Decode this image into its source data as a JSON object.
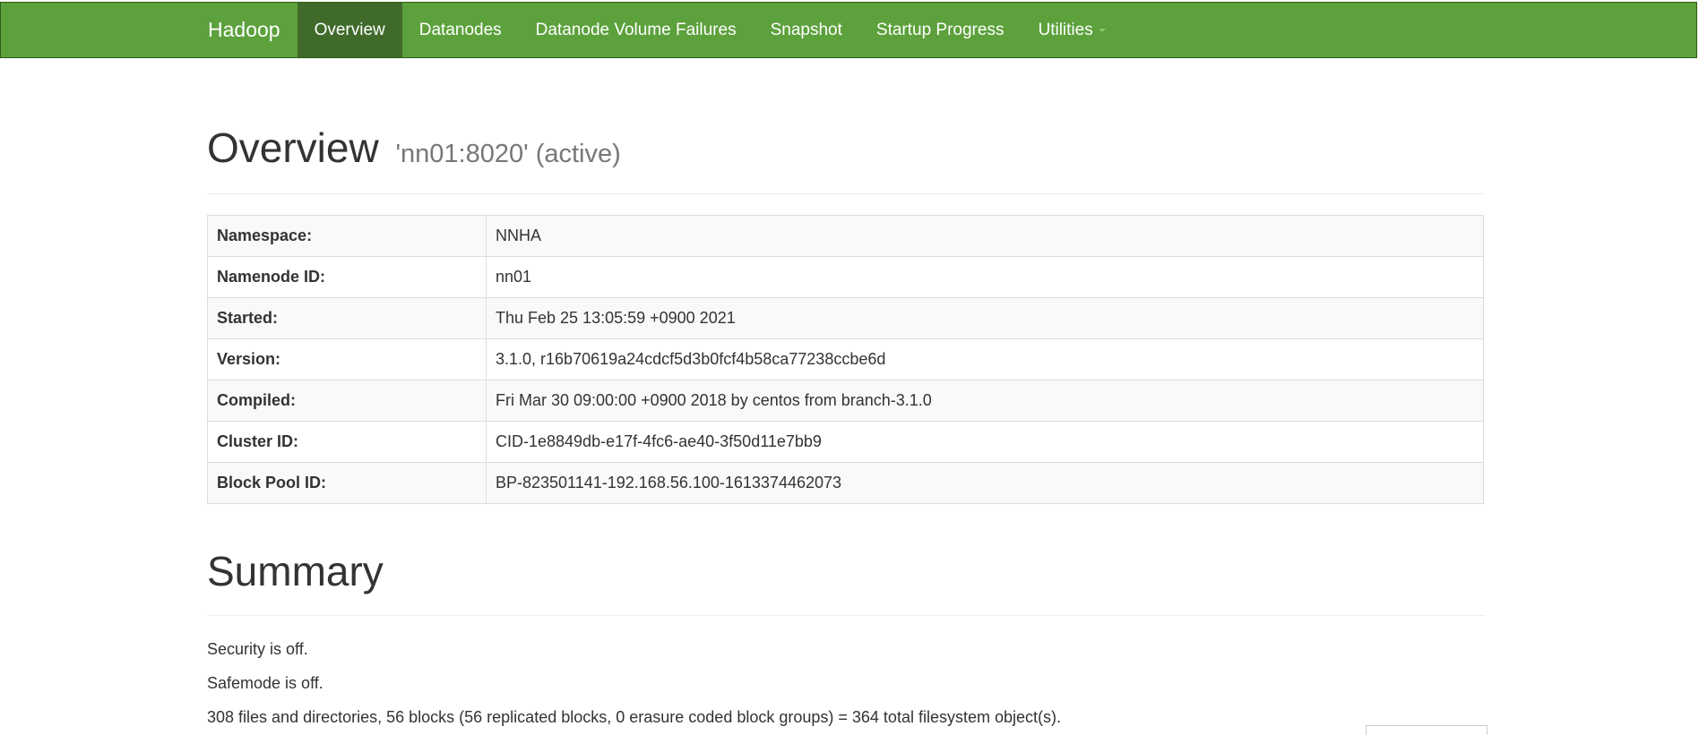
{
  "navbar": {
    "brand": "Hadoop",
    "items": [
      {
        "label": "Overview",
        "active": true
      },
      {
        "label": "Datanodes",
        "active": false
      },
      {
        "label": "Datanode Volume Failures",
        "active": false
      },
      {
        "label": "Snapshot",
        "active": false
      },
      {
        "label": "Startup Progress",
        "active": false
      },
      {
        "label": "Utilities",
        "active": false,
        "dropdown": true
      }
    ],
    "colors": {
      "background": "#5ca13c",
      "active": "#3f6a2a"
    }
  },
  "overview": {
    "title": "Overview",
    "subtitle": "'nn01:8020' (active)",
    "rows": [
      {
        "label": "Namespace:",
        "value": "NNHA"
      },
      {
        "label": "Namenode ID:",
        "value": "nn01"
      },
      {
        "label": "Started:",
        "value": "Thu Feb 25 13:05:59 +0900 2021"
      },
      {
        "label": "Version:",
        "value": "3.1.0, r16b70619a24cdcf5d3b0fcf4b58ca77238ccbe6d"
      },
      {
        "label": "Compiled:",
        "value": "Fri Mar 30 09:00:00 +0900 2018 by centos from branch-3.1.0"
      },
      {
        "label": "Cluster ID:",
        "value": "CID-1e8849db-e17f-4fc6-ae40-3f50d11e7bb9"
      },
      {
        "label": "Block Pool ID:",
        "value": "BP-823501141-192.168.56.100-1613374462073"
      }
    ]
  },
  "summary": {
    "title": "Summary",
    "lines": [
      "Security is off.",
      "Safemode is off.",
      "308 files and directories, 56 blocks (56 replicated blocks, 0 erasure coded block groups) = 364 total filesystem object(s)."
    ]
  }
}
